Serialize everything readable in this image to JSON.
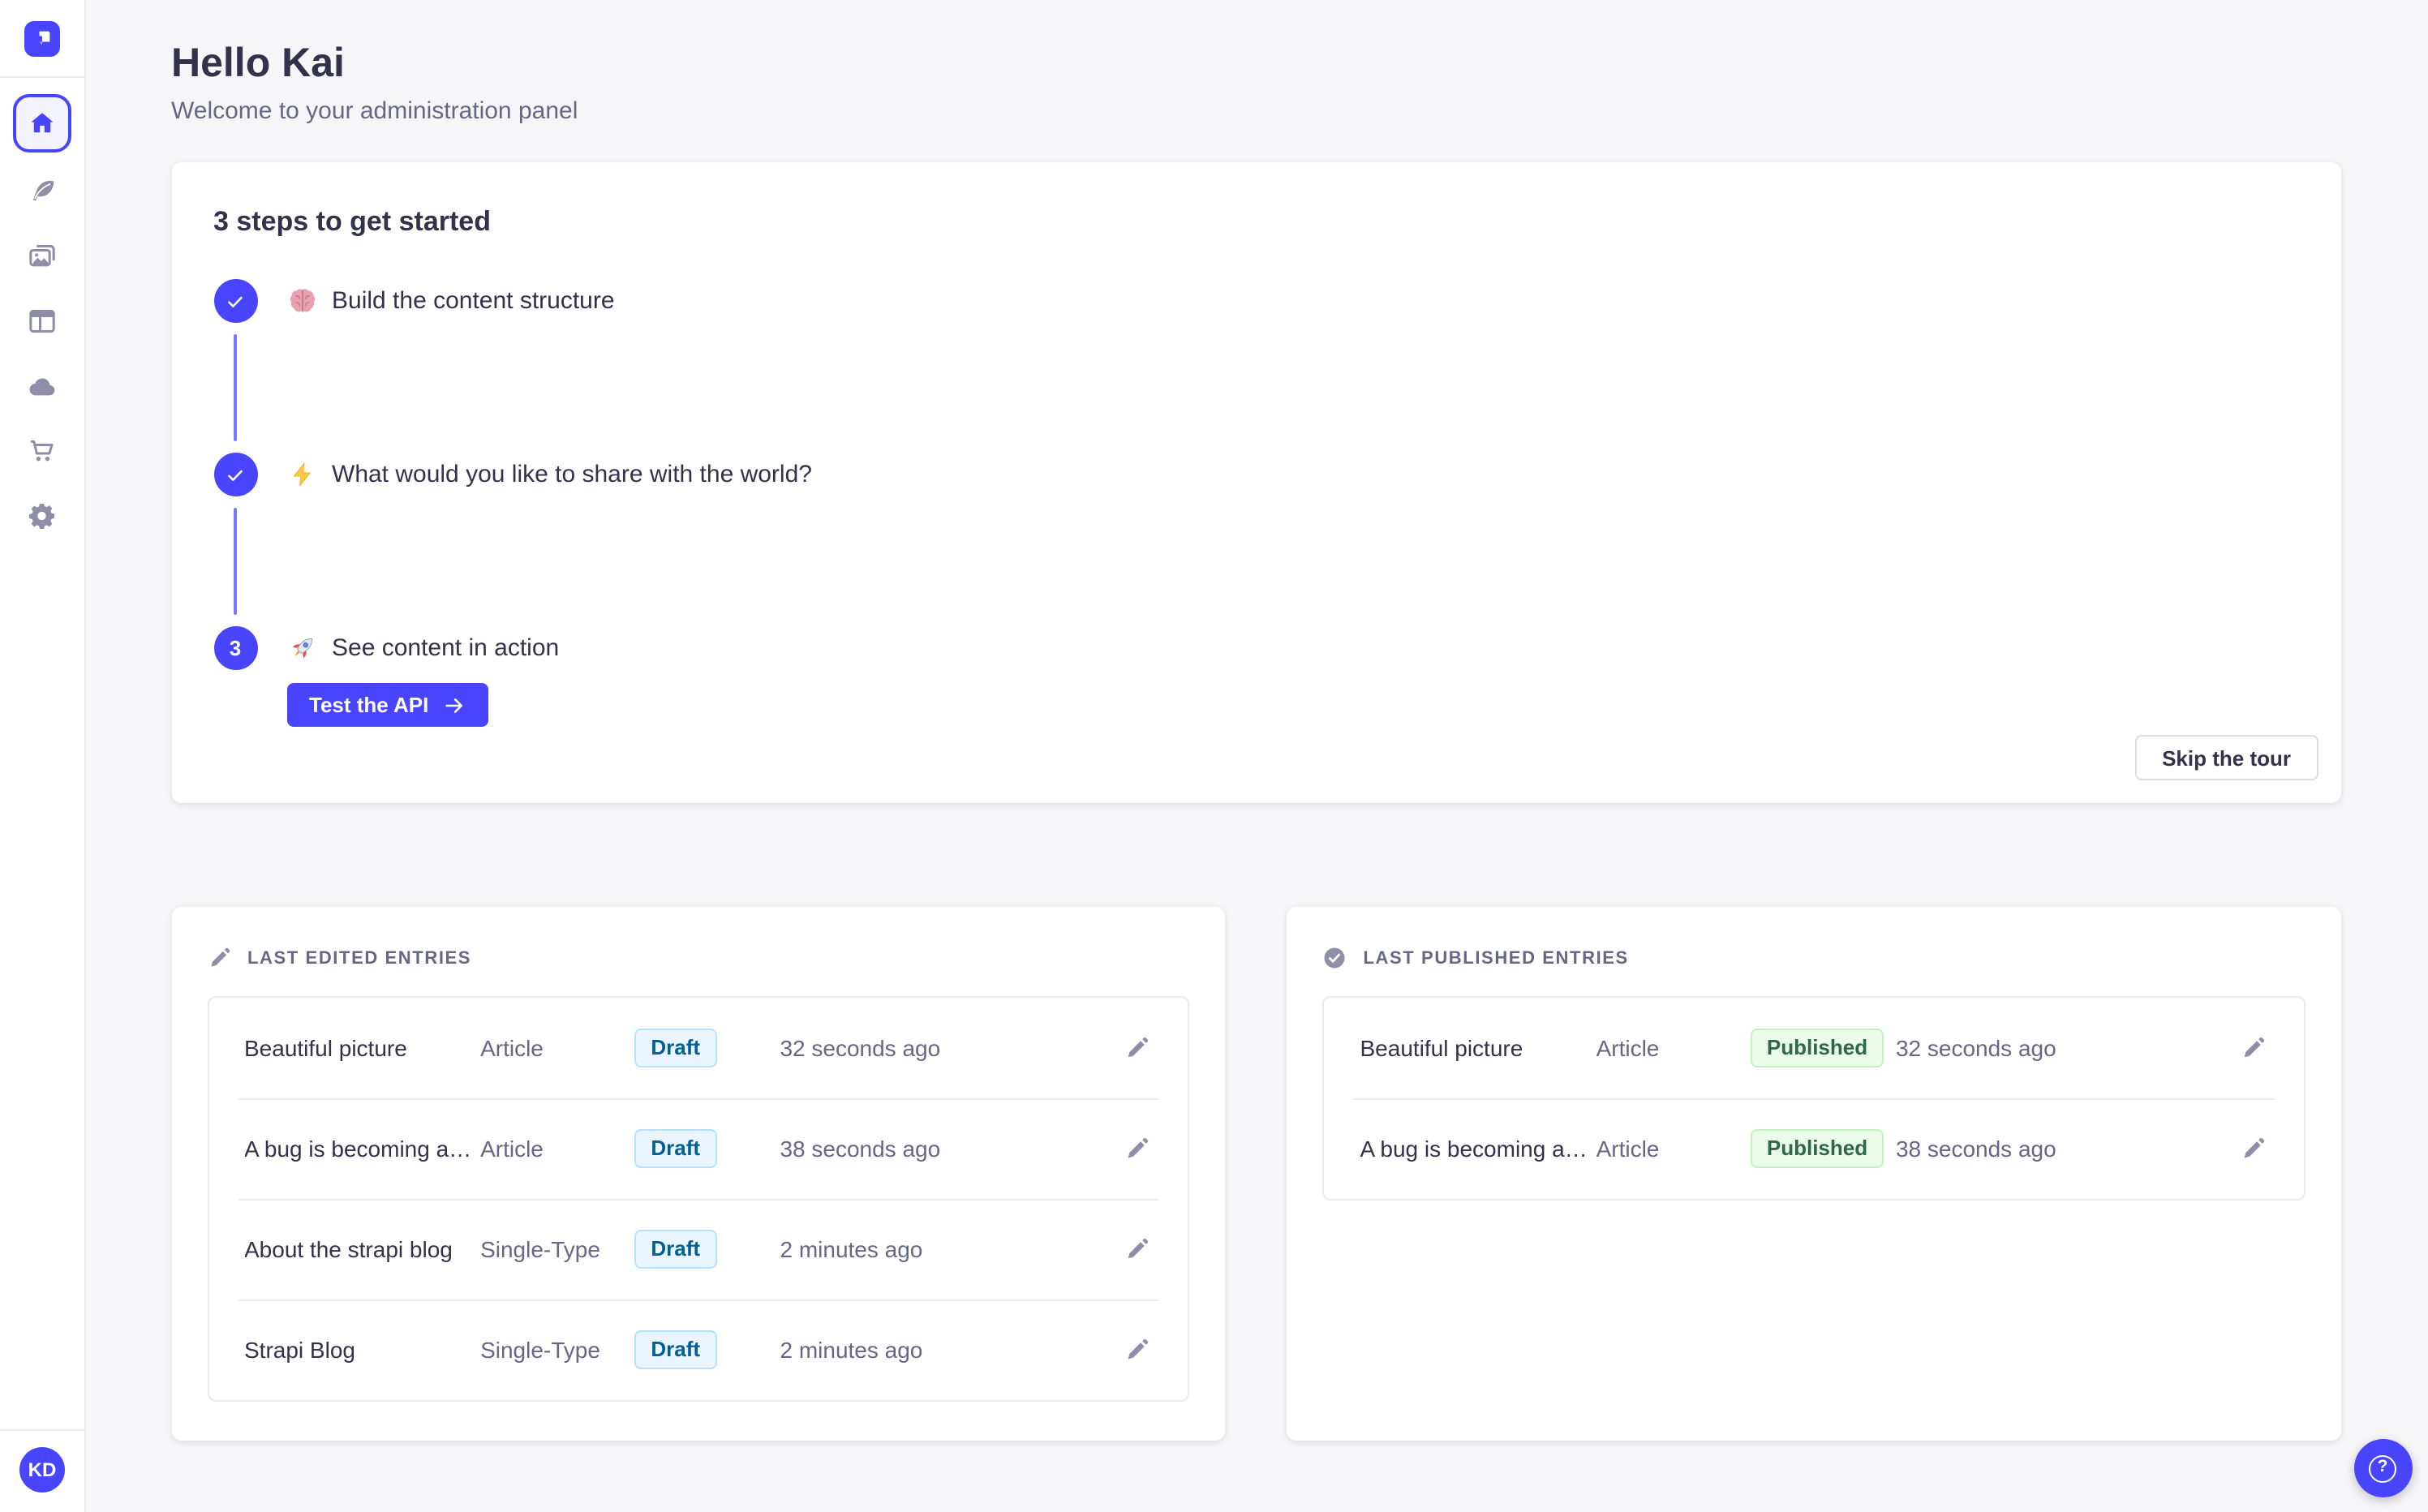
{
  "app": {
    "name": "Strapi administration panel",
    "colors": {
      "accent": "#4945FF",
      "accent_light_line": "#7B79FF",
      "background": "#F6F6F9",
      "text_dark": "#32324D",
      "text_muted": "#666687",
      "icon_muted": "#8E8EA9",
      "border": "#EAEAEF",
      "draft_bg": "#EAF5FF",
      "draft_border": "#B8E1FF",
      "draft_text": "#006096",
      "published_bg": "#EAFBE7",
      "published_border": "#C6F0C2",
      "published_text": "#2F6846"
    }
  },
  "sidebar": {
    "logo_icon": "strapi-logo",
    "nav_icons": [
      {
        "icon": "home-icon",
        "active": true
      },
      {
        "icon": "feather-icon",
        "active": false
      },
      {
        "icon": "media-icon",
        "active": false
      },
      {
        "icon": "layout-icon",
        "active": false
      },
      {
        "icon": "cloud-icon",
        "active": false
      },
      {
        "icon": "cart-icon",
        "active": false
      },
      {
        "icon": "gear-icon",
        "active": false
      }
    ],
    "avatar_initials": "KD"
  },
  "header": {
    "title": "Hello Kai",
    "subtitle": "Welcome to your administration panel"
  },
  "onboarding": {
    "title": "3 steps to get started",
    "steps": [
      {
        "number": 1,
        "done": true,
        "emoji": "brain",
        "label": "Build the content structure"
      },
      {
        "number": 2,
        "done": true,
        "emoji": "zap",
        "label": "What would you like to share with the world?"
      },
      {
        "number": 3,
        "done": false,
        "emoji": "rocket",
        "label": "See content in action",
        "cta": "Test the API"
      }
    ],
    "skip_label": "Skip the tour"
  },
  "panels": {
    "edited": {
      "title": "LAST EDITED ENTRIES",
      "icon": "pencil-icon",
      "rows": [
        {
          "title": "Beautiful picture",
          "type": "Article",
          "status": "Draft",
          "time": "32 seconds ago"
        },
        {
          "title": "A bug is becoming a…",
          "type": "Article",
          "status": "Draft",
          "time": "38 seconds ago"
        },
        {
          "title": "About the strapi blog",
          "type": "Single-Type",
          "status": "Draft",
          "time": "2 minutes ago"
        },
        {
          "title": "Strapi Blog",
          "type": "Single-Type",
          "status": "Draft",
          "time": "2 minutes ago"
        }
      ]
    },
    "published": {
      "title": "LAST PUBLISHED ENTRIES",
      "icon": "check-circle-icon",
      "rows": [
        {
          "title": "Beautiful picture",
          "type": "Article",
          "status": "Published",
          "time": "32 seconds ago"
        },
        {
          "title": "A bug is becoming a…",
          "type": "Article",
          "status": "Published",
          "time": "38 seconds ago"
        }
      ]
    }
  },
  "help": {
    "icon": "question-circle-icon"
  }
}
